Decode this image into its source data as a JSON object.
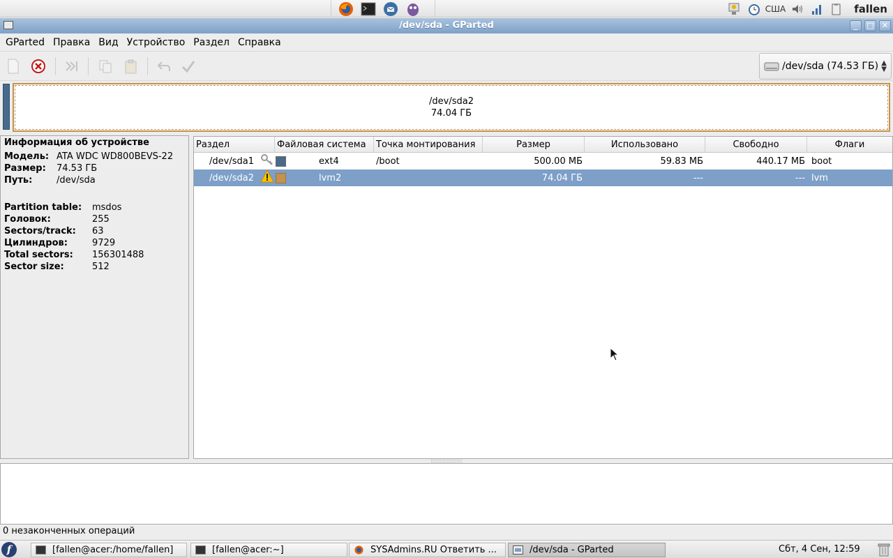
{
  "top_panel": {
    "launchers": [
      "firefox-icon",
      "terminal-icon",
      "thunderbird-icon",
      "pidgin-icon"
    ],
    "tray": {
      "keyboard_layout": "США",
      "user": "fallen"
    }
  },
  "window": {
    "title": "/dev/sda - GParted"
  },
  "menu": [
    "GParted",
    "Правка",
    "Вид",
    "Устройство",
    "Раздел",
    "Справка"
  ],
  "device_selector": {
    "value": "/dev/sda  (74.53 ГБ)"
  },
  "partition_map": {
    "name": "/dev/sda2",
    "size": "74.04 ГБ"
  },
  "device_info": {
    "header": "Информация об устройстве",
    "model_label": "Модель:",
    "model": "ATA WDC WD800BEVS-22",
    "size_label": "Размер:",
    "size": "74.53 ГБ",
    "path_label": "Путь:",
    "path": "/dev/sda",
    "table_label": "Partition table:",
    "table": "msdos",
    "heads_label": "Головок:",
    "heads": "255",
    "spt_label": "Sectors/track:",
    "spt": "63",
    "cyl_label": "Цилиндров:",
    "cyl": "9729",
    "total_label": "Total sectors:",
    "total": "156301488",
    "ss_label": "Sector size:",
    "ss": "512"
  },
  "table": {
    "columns": [
      "Раздел",
      "Файловая система",
      "Точка монтирования",
      "Размер",
      "Использовано",
      "Свободно",
      "Флаги"
    ],
    "rows": [
      {
        "partition": "/dev/sda1",
        "status_icon": "key-icon",
        "fs_color": "#4a6a8a",
        "fs": "ext4",
        "mount": "/boot",
        "size": "500.00 МБ",
        "used": "59.83 МБ",
        "free": "440.17 МБ",
        "flags": "boot"
      },
      {
        "partition": "/dev/sda2",
        "status_icon": "warning-icon",
        "fs_color": "#c39251",
        "fs": "lvm2",
        "mount": "",
        "size": "74.04 ГБ",
        "used": "---",
        "free": "---",
        "flags": "lvm"
      }
    ]
  },
  "status": "0 незаконченных операций",
  "taskbar": {
    "tasks": [
      "[fallen@acer:/home/fallen]",
      "[fallen@acer:~]",
      "SYSAdmins.RU Ответить ...",
      "/dev/sda - GParted"
    ],
    "clock": "Сбт, 4 Сен, 12:59"
  },
  "colors": {
    "selection": "#7d9fc8",
    "titlebar": "#8eadd1",
    "lvm": "#c39251",
    "ext4": "#4a6a8a"
  }
}
